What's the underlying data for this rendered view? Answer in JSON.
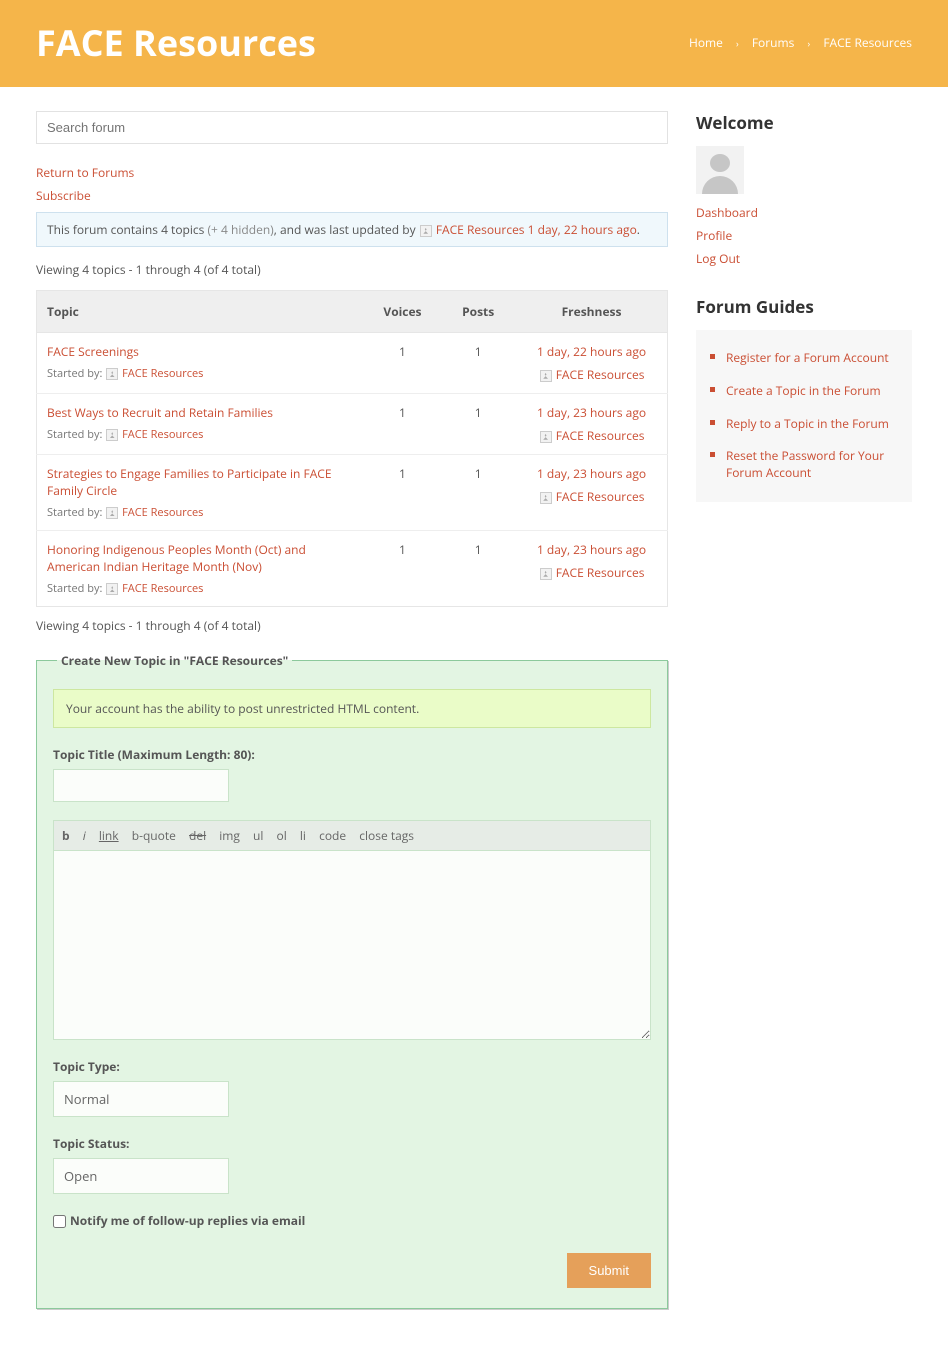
{
  "header": {
    "title": "FACE Resources",
    "breadcrumb": [
      "Home",
      "Forums",
      "FACE Resources"
    ]
  },
  "search": {
    "placeholder": "Search forum"
  },
  "links": {
    "return": "Return to Forums",
    "subscribe": "Subscribe"
  },
  "info": {
    "prefix": "This forum contains 4 topics ",
    "hidden": "(+ 4 hidden)",
    "middle": ", and was last updated by ",
    "updater": "FACE Resources",
    "time": " 1 day, 22 hours ago",
    "suffix": "."
  },
  "view_text": "Viewing 4 topics - 1 through 4 (of 4 total)",
  "table": {
    "headers": [
      "Topic",
      "Voices",
      "Posts",
      "Freshness"
    ],
    "started_by": "Started by:",
    "author": "FACE Resources",
    "rows": [
      {
        "title": "FACE Screenings",
        "voices": "1",
        "posts": "1",
        "freshness": "1 day, 22 hours ago"
      },
      {
        "title": "Best Ways to Recruit and Retain Families",
        "voices": "1",
        "posts": "1",
        "freshness": "1 day, 23 hours ago"
      },
      {
        "title": "Strategies to Engage Families to Participate in FACE Family Circle",
        "voices": "1",
        "posts": "1",
        "freshness": "1 day, 23 hours ago"
      },
      {
        "title": "Honoring Indigenous Peoples Month (Oct) and American Indian Heritage Month (Nov)",
        "voices": "1",
        "posts": "1",
        "freshness": "1 day, 23 hours ago"
      }
    ]
  },
  "form": {
    "legend": "Create New Topic in \"FACE Resources\"",
    "notice": "Your account has the ability to post unrestricted HTML content.",
    "title_label": "Topic Title (Maximum Length: 80):",
    "toolbar": {
      "b": "b",
      "i": "i",
      "link": "link",
      "bquote": "b-quote",
      "del": "del",
      "img": "img",
      "ul": "ul",
      "ol": "ol",
      "li": "li",
      "code": "code",
      "close": "close tags"
    },
    "type_label": "Topic Type:",
    "type_value": "Normal",
    "status_label": "Topic Status:",
    "status_value": "Open",
    "notify": "Notify me of follow-up replies via email",
    "submit": "Submit"
  },
  "sidebar": {
    "welcome": "Welcome",
    "links": [
      "Dashboard",
      "Profile",
      "Log Out"
    ],
    "guides_title": "Forum Guides",
    "guides": [
      "Register for a Forum Account",
      "Create a Topic in the Forum",
      "Reply to a Topic in the Forum",
      "Reset the Password for Your Forum Account"
    ]
  }
}
